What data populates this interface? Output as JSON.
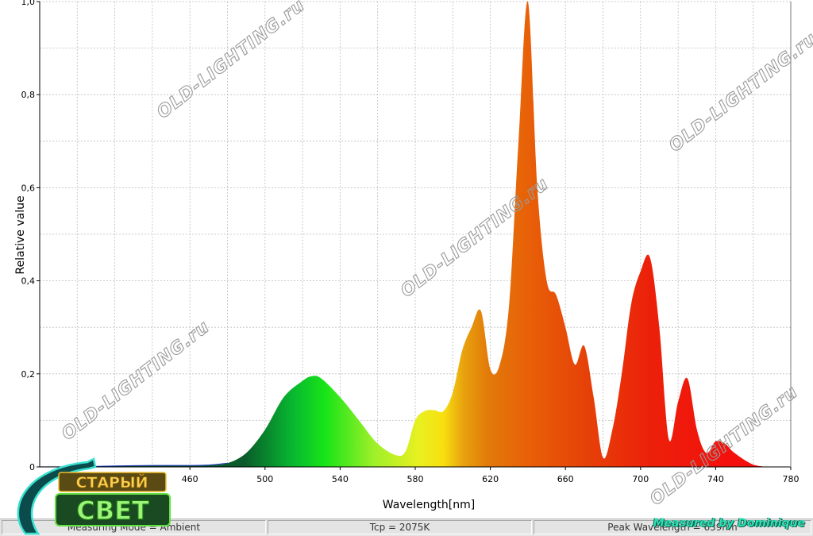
{
  "chart_data": {
    "type": "area",
    "title": "",
    "xlabel": "Wavelength[nm]",
    "ylabel": "Relative value",
    "xlim": [
      380,
      780
    ],
    "ylim": [
      0,
      1.0
    ],
    "xticks": [
      "460",
      "500",
      "540",
      "580",
      "620",
      "660",
      "700",
      "740",
      "780"
    ],
    "yticks": [
      "0",
      "0,2",
      "0,4",
      "0,6",
      "0,8",
      "1,0"
    ],
    "grid": true,
    "legend": "none",
    "series": [
      {
        "x": [
          380,
          400,
          420,
          440,
          460,
          470,
          480,
          490,
          500,
          510,
          520,
          525,
          530,
          540,
          550,
          560,
          570,
          575,
          580,
          585,
          590,
          595,
          600,
          605,
          610,
          615,
          620,
          625,
          630,
          635,
          640,
          645,
          650,
          655,
          660,
          665,
          670,
          675,
          680,
          685,
          690,
          695,
          700,
          705,
          710,
          715,
          720,
          725,
          730,
          735,
          740,
          745,
          750,
          760,
          770
        ],
        "y": [
          0,
          0,
          0.002,
          0.003,
          0.003,
          0.004,
          0.008,
          0.03,
          0.08,
          0.15,
          0.185,
          0.195,
          0.19,
          0.15,
          0.1,
          0.05,
          0.025,
          0.035,
          0.1,
          0.12,
          0.122,
          0.12,
          0.16,
          0.25,
          0.3,
          0.335,
          0.21,
          0.22,
          0.35,
          0.7,
          1.0,
          0.6,
          0.4,
          0.37,
          0.3,
          0.22,
          0.26,
          0.15,
          0.02,
          0.08,
          0.2,
          0.35,
          0.42,
          0.45,
          0.3,
          0.06,
          0.14,
          0.19,
          0.08,
          0.03,
          0.055,
          0.05,
          0.03,
          0.005,
          0
        ]
      }
    ]
  },
  "status_bar": {
    "measuring_mode": "Measuring Mode = Ambient",
    "tcp": "Tcp = 2075K",
    "peak_wavelength": "Peak Wavelength = 639nm"
  },
  "watermark": "OLD-LIGHTING.ru",
  "logo": {
    "line1": "СТАРЫЙ",
    "line2": "СВЕТ"
  },
  "credit": "Measured by Dominique",
  "colors": {
    "grid": "#bdbdbd",
    "axis": "#000000",
    "statusbar": "#e4e4e4",
    "credit": "#2fe0b6"
  }
}
